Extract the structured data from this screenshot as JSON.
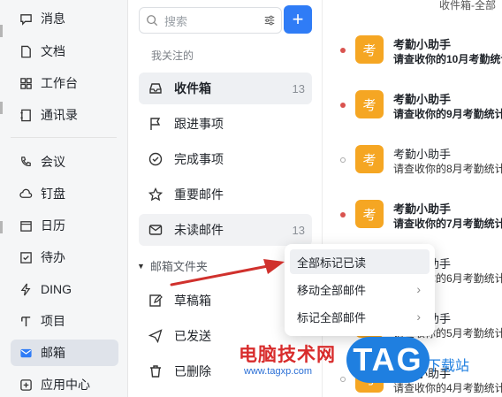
{
  "nav": {
    "items": [
      {
        "label": "消息",
        "icon": "chat-icon"
      },
      {
        "label": "文档",
        "icon": "doc-icon"
      },
      {
        "label": "工作台",
        "icon": "grid-icon"
      },
      {
        "label": "通讯录",
        "icon": "contacts-icon"
      },
      {
        "label": "会议",
        "icon": "phone-icon"
      },
      {
        "label": "钉盘",
        "icon": "cloud-icon"
      },
      {
        "label": "日历",
        "icon": "calendar-icon"
      },
      {
        "label": "待办",
        "icon": "todo-icon"
      },
      {
        "label": "DING",
        "icon": "lightning-icon"
      },
      {
        "label": "项目",
        "icon": "project-icon"
      },
      {
        "label": "邮箱",
        "icon": "mail-icon",
        "active": true
      },
      {
        "label": "应用中心",
        "icon": "apps-icon"
      }
    ]
  },
  "folders": {
    "search_placeholder": "搜索",
    "add_label": "+",
    "followed_title": "我关注的",
    "items": [
      {
        "label": "收件箱",
        "count": "13"
      },
      {
        "label": "跟进事项",
        "count": ""
      },
      {
        "label": "完成事项",
        "count": ""
      },
      {
        "label": "重要邮件",
        "count": ""
      },
      {
        "label": "未读邮件",
        "count": "13"
      }
    ],
    "group_title": "邮箱文件夹",
    "group_items": [
      {
        "label": "草稿箱"
      },
      {
        "label": "已发送"
      },
      {
        "label": "已删除"
      }
    ]
  },
  "messages": {
    "breadcrumb": "收件箱-全部",
    "items": [
      {
        "avatar": "考",
        "from": "考勤小助手",
        "subject": "请查收你的10月考勤统计",
        "unread": true
      },
      {
        "avatar": "考",
        "from": "考勤小助手",
        "subject": "请查收你的9月考勤统计",
        "unread": true
      },
      {
        "avatar": "考",
        "from": "考勤小助手",
        "subject": "请查收你的8月考勤统计",
        "unread": false
      },
      {
        "avatar": "考",
        "from": "考勤小助手",
        "subject": "请查收你的7月考勤统计",
        "unread": true
      },
      {
        "avatar": "考",
        "from": "考勤小助手",
        "subject": "请查收你的6月考勤统计",
        "unread": false
      },
      {
        "avatar": "考",
        "from": "考勤小助手",
        "subject": "请查收你的5月考勤统计",
        "unread": false
      },
      {
        "avatar": "考",
        "from": "考勤小助手",
        "subject": "请查收你的4月考勤统计",
        "unread": false
      }
    ]
  },
  "context_menu": {
    "items": [
      {
        "label": "全部标记已读"
      },
      {
        "label": "移动全部邮件"
      },
      {
        "label": "标记全部邮件"
      }
    ]
  },
  "watermark": {
    "text": "电脑技术网",
    "url": "www.tagxp.com",
    "logo": "TAG",
    "sub": "下载站"
  },
  "colors": {
    "accent": "#2f7cf6",
    "unread_dot": "#d9534f",
    "avatar": "#f5a623"
  }
}
